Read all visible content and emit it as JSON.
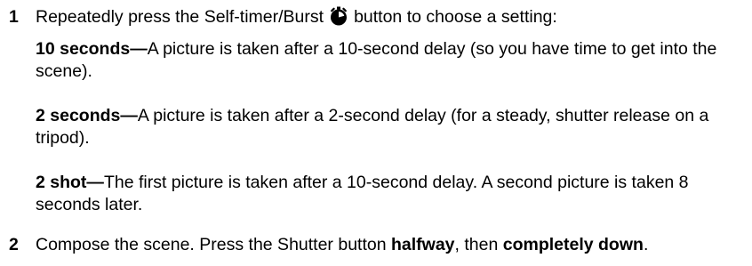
{
  "steps": [
    {
      "number": "1",
      "text_before": "Repeatedly press the Self-timer/Burst",
      "icon": "self-timer-icon",
      "text_after": "button to choose a setting:"
    },
    {
      "number": "2",
      "text_before": "Compose the scene. Press the Shutter button",
      "bold_1": "halfway",
      "text_middle": ", then",
      "bold_2": "completely down",
      "text_end": "."
    }
  ],
  "settings": [
    {
      "term": "10 seconds—",
      "description": "A picture is taken after a 10-second delay (so you have time to get into the scene)."
    },
    {
      "term": "2 seconds—",
      "description": "A picture is taken after a 2-second delay (for a steady, shutter release on a tripod)."
    },
    {
      "term": "2 shot—",
      "description": "The first picture is taken after a 10-second delay. A second picture is taken 8 seconds later."
    }
  ]
}
